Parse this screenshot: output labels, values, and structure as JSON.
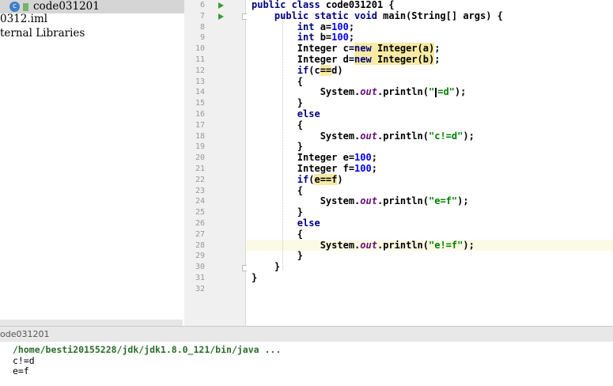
{
  "project_panel": {
    "items": [
      {
        "label": "code031201",
        "icon": "class-icon",
        "selected": true
      },
      {
        "label": "0312.iml",
        "icon": "",
        "selected": false
      },
      {
        "label": "ternal Libraries",
        "icon": "",
        "selected": false
      }
    ]
  },
  "editor": {
    "line_numbers": [
      "6",
      "7",
      "8",
      "9",
      "10",
      "11",
      "12",
      "13",
      "14",
      "15",
      "16",
      "17",
      "18",
      "19",
      "20",
      "21",
      "22",
      "23",
      "24",
      "25",
      "26",
      "27",
      "28",
      "29",
      "30",
      "31",
      "32"
    ],
    "current_line": "28",
    "run_marker_lines": [
      "6",
      "7"
    ]
  },
  "run_panel": {
    "title": "ode031201"
  },
  "console": {
    "command": "/home/besti20155228/jdk/jdk1.8.0_121/bin/java ...",
    "output": [
      "c!=d",
      "e=f"
    ]
  }
}
